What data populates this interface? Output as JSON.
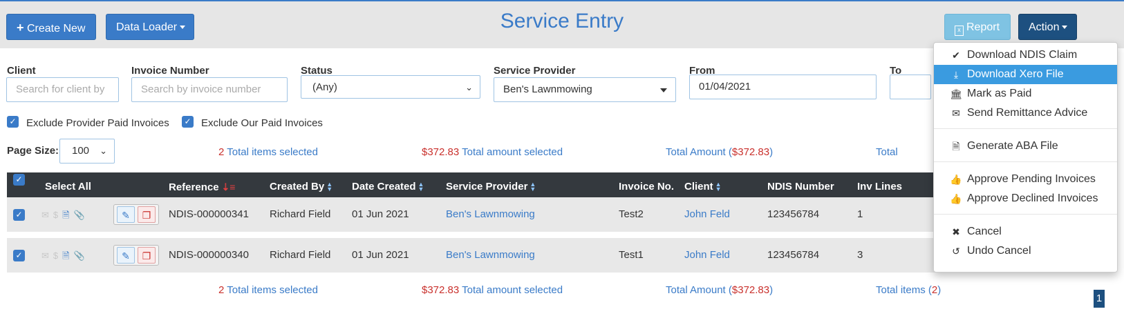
{
  "toolbar": {
    "create_new": "Create New",
    "data_loader": "Data Loader",
    "title": "Service Entry",
    "report": "Report",
    "action": "Action"
  },
  "filters": {
    "client_label": "Client",
    "client_placeholder": "Search for client by",
    "invoice_label": "Invoice Number",
    "invoice_placeholder": "Search by invoice number",
    "status_label": "Status",
    "status_value": "(Any)",
    "provider_label": "Service Provider",
    "provider_value": "Ben's Lawnmowing",
    "from_label": "From",
    "from_value": "01/04/2021",
    "to_label": "To"
  },
  "options": {
    "exclude_provider_paid": "Exclude Provider Paid Invoices",
    "exclude_our_paid": "Exclude Our Paid Invoices"
  },
  "page_size": {
    "label": "Page Size:",
    "value": "100"
  },
  "summary": {
    "selected_count": "2",
    "selected_label": "Total items selected",
    "amount_selected": "$372.83",
    "amount_selected_label": "Total amount selected",
    "total_amount_label": "Total Amount (",
    "total_amount": "$372.83",
    "close_paren": ")",
    "total_items_label": "Total items (",
    "total_items": "2",
    "total_top_partial": "Total"
  },
  "table": {
    "headers": {
      "select_all": "Select All",
      "reference": "Reference",
      "created_by": "Created By",
      "date_created": "Date Created",
      "service_provider": "Service Provider",
      "invoice_no": "Invoice No.",
      "client": "Client",
      "ndis_number": "NDIS Number",
      "inv_lines": "Inv Lines"
    },
    "rows": [
      {
        "reference": "NDIS-000000341",
        "created_by": "Richard Field",
        "date_created": "01 Jun 2021",
        "service_provider": "Ben's Lawnmowing",
        "invoice_no": "Test2",
        "client": "John Feld",
        "ndis_number": "123456784",
        "inv_lines": "1"
      },
      {
        "reference": "NDIS-000000340",
        "created_by": "Richard Field",
        "date_created": "01 Jun 2021",
        "service_provider": "Ben's Lawnmowing",
        "invoice_no": "Test1",
        "client": "John Feld",
        "ndis_number": "123456784",
        "inv_lines": "3"
      }
    ]
  },
  "pagination": {
    "current_page": "1"
  },
  "action_menu": {
    "items": [
      {
        "label": "Download NDIS Claim",
        "icon": "check-icon"
      },
      {
        "label": "Download Xero File",
        "icon": "download-icon",
        "active": true
      },
      {
        "label": "Mark as Paid",
        "icon": "bank-icon"
      },
      {
        "label": "Send Remittance Advice",
        "icon": "envelope-icon"
      },
      {
        "label": "Generate ABA File",
        "icon": "file-icon"
      },
      {
        "label": "Approve Pending Invoices",
        "icon": "thumbs-up-outline-icon"
      },
      {
        "label": "Approve Declined Invoices",
        "icon": "thumbs-up-icon"
      },
      {
        "label": "Cancel",
        "icon": "times-icon"
      },
      {
        "label": "Undo Cancel",
        "icon": "undo-icon"
      }
    ]
  },
  "colors": {
    "primary": "#3a7bc8",
    "navy": "#1d5080",
    "header_dark": "#34393e",
    "highlight": "#3a9be0",
    "negative": "#c9302c"
  }
}
